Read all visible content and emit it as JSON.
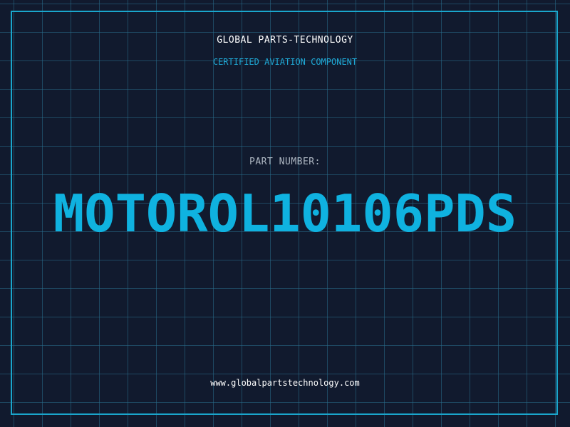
{
  "header": {
    "company": "GLOBAL PARTS-TECHNOLOGY",
    "subtitle": "CERTIFIED AVIATION COMPONENT"
  },
  "part": {
    "label": "PART NUMBER:",
    "number": "MOTOROL10106PDS"
  },
  "footer": {
    "website": "www.globalpartstechnology.com"
  },
  "colors": {
    "background": "#111a2e",
    "grid": "#286e8c",
    "frame": "#1aa6cc",
    "accent": "#0fb2e0"
  }
}
